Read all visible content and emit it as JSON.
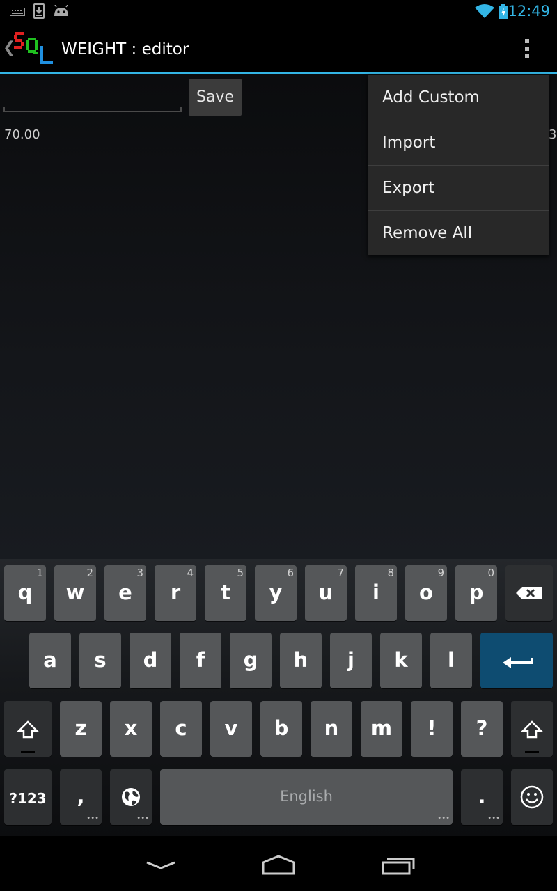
{
  "status_bar": {
    "time": "12:49",
    "icons": [
      "keyboard-icon",
      "download-icon",
      "android-icon",
      "wifi-icon",
      "battery-charging-icon"
    ],
    "accent_color": "#33b5e5"
  },
  "action_bar": {
    "title": "WEIGHT : editor",
    "accent_color": "#33b5e5"
  },
  "editor": {
    "input_value": "",
    "save_label": "Save",
    "rows": [
      {
        "value": "70.00",
        "trailing": "3"
      }
    ]
  },
  "menu": {
    "items": [
      {
        "label": "Add Custom"
      },
      {
        "label": "Import"
      },
      {
        "label": "Export"
      },
      {
        "label": "Remove All"
      }
    ]
  },
  "keyboard": {
    "row1": [
      {
        "label": "q",
        "hint": "1"
      },
      {
        "label": "w",
        "hint": "2"
      },
      {
        "label": "e",
        "hint": "3"
      },
      {
        "label": "r",
        "hint": "4"
      },
      {
        "label": "t",
        "hint": "5"
      },
      {
        "label": "y",
        "hint": "6"
      },
      {
        "label": "u",
        "hint": "7"
      },
      {
        "label": "i",
        "hint": "8"
      },
      {
        "label": "o",
        "hint": "9"
      },
      {
        "label": "p",
        "hint": "0"
      }
    ],
    "row2": [
      "a",
      "s",
      "d",
      "f",
      "g",
      "h",
      "j",
      "k",
      "l"
    ],
    "row3": [
      "z",
      "x",
      "c",
      "v",
      "b",
      "n",
      "m",
      "!",
      "?"
    ],
    "symbols_label": "?123",
    "comma_label": ",",
    "space_label": "English",
    "period_label": ".",
    "enter_color": "#0e4c71"
  }
}
